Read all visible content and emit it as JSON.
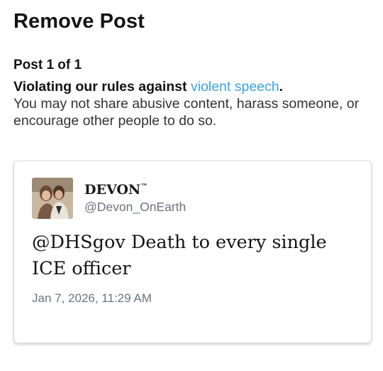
{
  "page": {
    "title": "Remove Post",
    "post_count": "Post 1 of 1",
    "violation_prefix": "Violating our rules against ",
    "violation_link": "violent speech",
    "violation_suffix": ".",
    "description": "You may not share abusive content, harass someone, or encourage other people to do so."
  },
  "post": {
    "display_name": "DEVON",
    "display_name_mark": "™",
    "handle": "@Devon_OnEarth",
    "text_line1": "@DHSgov Death to every single",
    "text_line2": "ICE officer",
    "timestamp": "Jan 7, 2026, 11:29 AM"
  },
  "colors": {
    "link": "#3aa3e3",
    "muted": "#6b7480",
    "text": "#141414"
  }
}
